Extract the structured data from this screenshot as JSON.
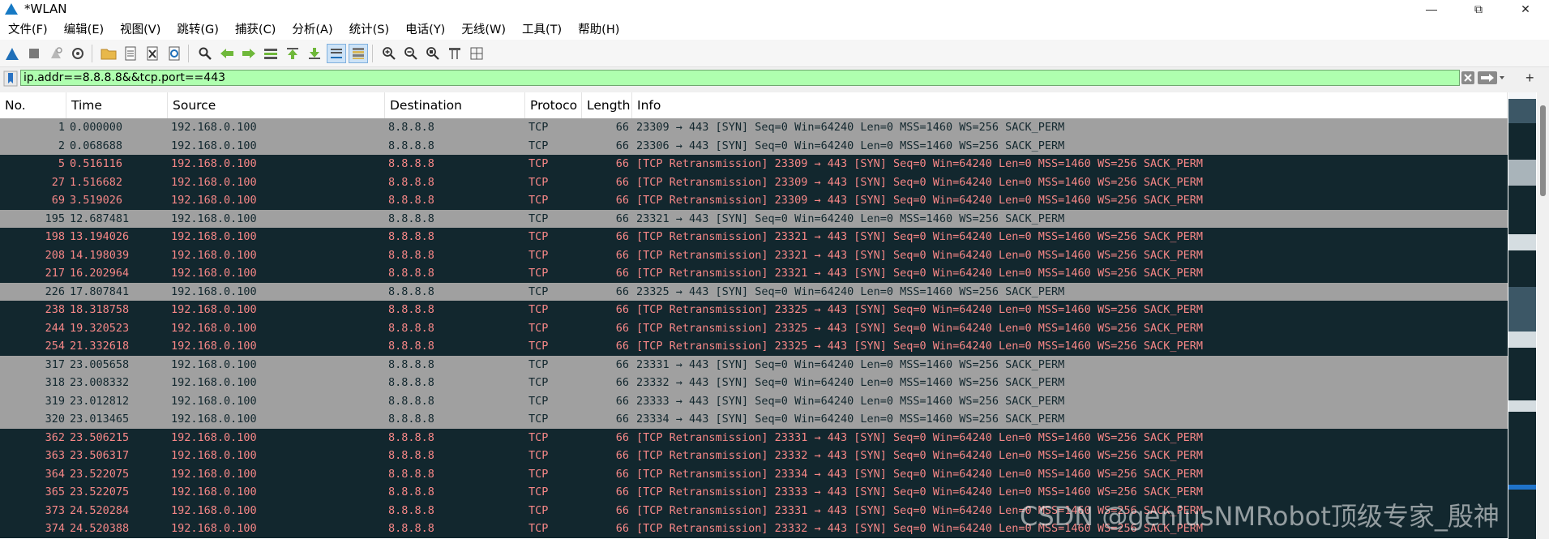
{
  "window": {
    "title": "*WLAN",
    "minimize_glyph": "—",
    "maximize_glyph": "⧉",
    "close_glyph": "✕"
  },
  "menu": [
    {
      "label": "文件(F)"
    },
    {
      "label": "编辑(E)"
    },
    {
      "label": "视图(V)"
    },
    {
      "label": "跳转(G)"
    },
    {
      "label": "捕获(C)"
    },
    {
      "label": "分析(A)"
    },
    {
      "label": "统计(S)"
    },
    {
      "label": "电话(Y)"
    },
    {
      "label": "无线(W)"
    },
    {
      "label": "工具(T)"
    },
    {
      "label": "帮助(H)"
    }
  ],
  "toolbar": {
    "icons": [
      "shark-fin-start-icon",
      "stop-icon",
      "restart-icon",
      "capture-options-icon",
      "open-folder-icon",
      "open-file-icon",
      "close-file-icon",
      "reload-icon",
      "find-icon",
      "go-back-icon",
      "go-forward-icon",
      "go-to-packet-icon",
      "first-packet-icon",
      "last-packet-icon",
      "autoscroll-icon",
      "colorize-icon",
      "zoom-in-icon",
      "zoom-out-icon",
      "zoom-normal-icon",
      "resize-columns-icon",
      "layout-icon"
    ]
  },
  "filter": {
    "value": "ip.addr==8.8.8.8&&tcp.port==443",
    "add_glyph": "+"
  },
  "columns": [
    {
      "label": "No."
    },
    {
      "label": "Time"
    },
    {
      "label": "Source"
    },
    {
      "label": "Destination"
    },
    {
      "label": "Protoco"
    },
    {
      "label": "Length"
    },
    {
      "label": "Info"
    }
  ],
  "packets": [
    {
      "no": "1",
      "time": "0.000000",
      "src": "192.168.0.100",
      "dst": "8.8.8.8",
      "proto": "TCP",
      "len": "66",
      "info": "23309 → 443 [SYN] Seq=0 Win=64240 Len=0 MSS=1460 WS=256 SACK_PERM",
      "style": "normal"
    },
    {
      "no": "2",
      "time": "0.068688",
      "src": "192.168.0.100",
      "dst": "8.8.8.8",
      "proto": "TCP",
      "len": "66",
      "info": "23306 → 443 [SYN] Seq=0 Win=64240 Len=0 MSS=1460 WS=256 SACK_PERM",
      "style": "normal"
    },
    {
      "no": "5",
      "time": "0.516116",
      "src": "192.168.0.100",
      "dst": "8.8.8.8",
      "proto": "TCP",
      "len": "66",
      "info": "[TCP Retransmission] 23309 → 443 [SYN] Seq=0 Win=64240 Len=0 MSS=1460 WS=256 SACK_PERM",
      "style": "retrans"
    },
    {
      "no": "27",
      "time": "1.516682",
      "src": "192.168.0.100",
      "dst": "8.8.8.8",
      "proto": "TCP",
      "len": "66",
      "info": "[TCP Retransmission] 23309 → 443 [SYN] Seq=0 Win=64240 Len=0 MSS=1460 WS=256 SACK_PERM",
      "style": "retrans"
    },
    {
      "no": "69",
      "time": "3.519026",
      "src": "192.168.0.100",
      "dst": "8.8.8.8",
      "proto": "TCP",
      "len": "66",
      "info": "[TCP Retransmission] 23309 → 443 [SYN] Seq=0 Win=64240 Len=0 MSS=1460 WS=256 SACK_PERM",
      "style": "retrans"
    },
    {
      "no": "195",
      "time": "12.687481",
      "src": "192.168.0.100",
      "dst": "8.8.8.8",
      "proto": "TCP",
      "len": "66",
      "info": "23321 → 443 [SYN] Seq=0 Win=64240 Len=0 MSS=1460 WS=256 SACK_PERM",
      "style": "normal"
    },
    {
      "no": "198",
      "time": "13.194026",
      "src": "192.168.0.100",
      "dst": "8.8.8.8",
      "proto": "TCP",
      "len": "66",
      "info": "[TCP Retransmission] 23321 → 443 [SYN] Seq=0 Win=64240 Len=0 MSS=1460 WS=256 SACK_PERM",
      "style": "retrans"
    },
    {
      "no": "208",
      "time": "14.198039",
      "src": "192.168.0.100",
      "dst": "8.8.8.8",
      "proto": "TCP",
      "len": "66",
      "info": "[TCP Retransmission] 23321 → 443 [SYN] Seq=0 Win=64240 Len=0 MSS=1460 WS=256 SACK_PERM",
      "style": "retrans"
    },
    {
      "no": "217",
      "time": "16.202964",
      "src": "192.168.0.100",
      "dst": "8.8.8.8",
      "proto": "TCP",
      "len": "66",
      "info": "[TCP Retransmission] 23321 → 443 [SYN] Seq=0 Win=64240 Len=0 MSS=1460 WS=256 SACK_PERM",
      "style": "retrans"
    },
    {
      "no": "226",
      "time": "17.807841",
      "src": "192.168.0.100",
      "dst": "8.8.8.8",
      "proto": "TCP",
      "len": "66",
      "info": "23325 → 443 [SYN] Seq=0 Win=64240 Len=0 MSS=1460 WS=256 SACK_PERM",
      "style": "normal"
    },
    {
      "no": "238",
      "time": "18.318758",
      "src": "192.168.0.100",
      "dst": "8.8.8.8",
      "proto": "TCP",
      "len": "66",
      "info": "[TCP Retransmission] 23325 → 443 [SYN] Seq=0 Win=64240 Len=0 MSS=1460 WS=256 SACK_PERM",
      "style": "retrans"
    },
    {
      "no": "244",
      "time": "19.320523",
      "src": "192.168.0.100",
      "dst": "8.8.8.8",
      "proto": "TCP",
      "len": "66",
      "info": "[TCP Retransmission] 23325 → 443 [SYN] Seq=0 Win=64240 Len=0 MSS=1460 WS=256 SACK_PERM",
      "style": "retrans"
    },
    {
      "no": "254",
      "time": "21.332618",
      "src": "192.168.0.100",
      "dst": "8.8.8.8",
      "proto": "TCP",
      "len": "66",
      "info": "[TCP Retransmission] 23325 → 443 [SYN] Seq=0 Win=64240 Len=0 MSS=1460 WS=256 SACK_PERM",
      "style": "retrans"
    },
    {
      "no": "317",
      "time": "23.005658",
      "src": "192.168.0.100",
      "dst": "8.8.8.8",
      "proto": "TCP",
      "len": "66",
      "info": "23331 → 443 [SYN] Seq=0 Win=64240 Len=0 MSS=1460 WS=256 SACK_PERM",
      "style": "normal"
    },
    {
      "no": "318",
      "time": "23.008332",
      "src": "192.168.0.100",
      "dst": "8.8.8.8",
      "proto": "TCP",
      "len": "66",
      "info": "23332 → 443 [SYN] Seq=0 Win=64240 Len=0 MSS=1460 WS=256 SACK_PERM",
      "style": "normal"
    },
    {
      "no": "319",
      "time": "23.012812",
      "src": "192.168.0.100",
      "dst": "8.8.8.8",
      "proto": "TCP",
      "len": "66",
      "info": "23333 → 443 [SYN] Seq=0 Win=64240 Len=0 MSS=1460 WS=256 SACK_PERM",
      "style": "normal"
    },
    {
      "no": "320",
      "time": "23.013465",
      "src": "192.168.0.100",
      "dst": "8.8.8.8",
      "proto": "TCP",
      "len": "66",
      "info": "23334 → 443 [SYN] Seq=0 Win=64240 Len=0 MSS=1460 WS=256 SACK_PERM",
      "style": "normal"
    },
    {
      "no": "362",
      "time": "23.506215",
      "src": "192.168.0.100",
      "dst": "8.8.8.8",
      "proto": "TCP",
      "len": "66",
      "info": "[TCP Retransmission] 23331 → 443 [SYN] Seq=0 Win=64240 Len=0 MSS=1460 WS=256 SACK_PERM",
      "style": "retrans"
    },
    {
      "no": "363",
      "time": "23.506317",
      "src": "192.168.0.100",
      "dst": "8.8.8.8",
      "proto": "TCP",
      "len": "66",
      "info": "[TCP Retransmission] 23332 → 443 [SYN] Seq=0 Win=64240 Len=0 MSS=1460 WS=256 SACK_PERM",
      "style": "retrans"
    },
    {
      "no": "364",
      "time": "23.522075",
      "src": "192.168.0.100",
      "dst": "8.8.8.8",
      "proto": "TCP",
      "len": "66",
      "info": "[TCP Retransmission] 23334 → 443 [SYN] Seq=0 Win=64240 Len=0 MSS=1460 WS=256 SACK_PERM",
      "style": "retrans"
    },
    {
      "no": "365",
      "time": "23.522075",
      "src": "192.168.0.100",
      "dst": "8.8.8.8",
      "proto": "TCP",
      "len": "66",
      "info": "[TCP Retransmission] 23333 → 443 [SYN] Seq=0 Win=64240 Len=0 MSS=1460 WS=256 SACK_PERM",
      "style": "retrans"
    },
    {
      "no": "373",
      "time": "24.520284",
      "src": "192.168.0.100",
      "dst": "8.8.8.8",
      "proto": "TCP",
      "len": "66",
      "info": "[TCP Retransmission] 23331 → 443 [SYN] Seq=0 Win=64240 Len=0 MSS=1460 WS=256 SACK_PERM",
      "style": "retrans"
    },
    {
      "no": "374",
      "time": "24.520388",
      "src": "192.168.0.100",
      "dst": "8.8.8.8",
      "proto": "TCP",
      "len": "66",
      "info": "[TCP Retransmission] 23332 → 443 [SYN] Seq=0 Win=64240 Len=0 MSS=1460 WS=256 SACK_PERM",
      "style": "retrans"
    }
  ],
  "colors": {
    "normal_row_bg": "#a0a0a0",
    "normal_row_fg": "#12272e",
    "retrans_row_bg": "#12272e",
    "retrans_row_fg": "#f78787",
    "filter_bg": "#afffaf"
  },
  "watermark": "CSDN @geniusNMRobot顶级专家_殷神"
}
